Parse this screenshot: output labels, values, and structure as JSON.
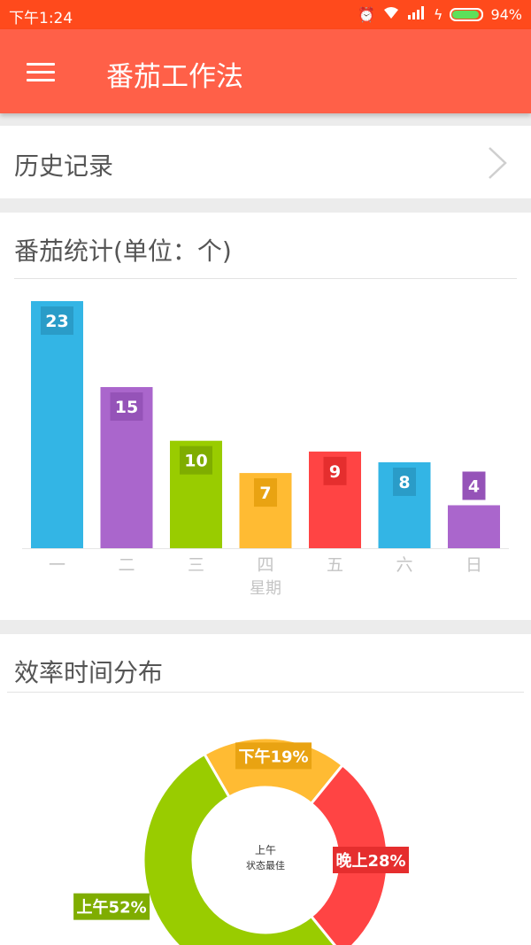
{
  "status_bar": {
    "time": "下午1:24",
    "battery": "94%",
    "icons": [
      "alarm-icon",
      "wifi-icon",
      "signal-icon",
      "charging-icon"
    ]
  },
  "app_bar": {
    "title": "番茄工作法",
    "menu_icon": "hamburger-menu-icon"
  },
  "history": {
    "label": "历史记录",
    "arrow_icon": "chevron-right-icon"
  },
  "stats": {
    "title": "番茄统计(单位：个)",
    "chart_data": {
      "type": "bar",
      "categories": [
        "一",
        "二",
        "三",
        "四",
        "五",
        "六",
        "日"
      ],
      "values": [
        23,
        15,
        10,
        7,
        9,
        8,
        4
      ],
      "colors": [
        "#33b5e5",
        "#aa66cc",
        "#99cc00",
        "#ffbb33",
        "#ff4444",
        "#33b5e5",
        "#aa66cc"
      ],
      "label_colors": [
        "#2a9cc8",
        "#9553b8",
        "#7fad00",
        "#e9a312",
        "#e52e2e",
        "#2a9cc8",
        "#9553b8"
      ],
      "xlabel": "星期",
      "ylabel": "",
      "ylim": [
        0,
        23
      ],
      "data_labels": true,
      "grid": false
    }
  },
  "efficiency": {
    "title": "效率时间分布",
    "chart_data": {
      "type": "pie",
      "donut": true,
      "center_text": [
        "上午",
        "状态最佳"
      ],
      "slices": [
        {
          "label": "下午19%",
          "value": 19,
          "color": "#ffbb33",
          "label_color": "#e9a312"
        },
        {
          "label": "晚上28%",
          "value": 28,
          "color": "#ff4444",
          "label_color": "#e52e2e"
        },
        {
          "label": "上午52%",
          "value": 52,
          "color": "#99cc00",
          "label_color": "#7fad00"
        }
      ]
    }
  }
}
